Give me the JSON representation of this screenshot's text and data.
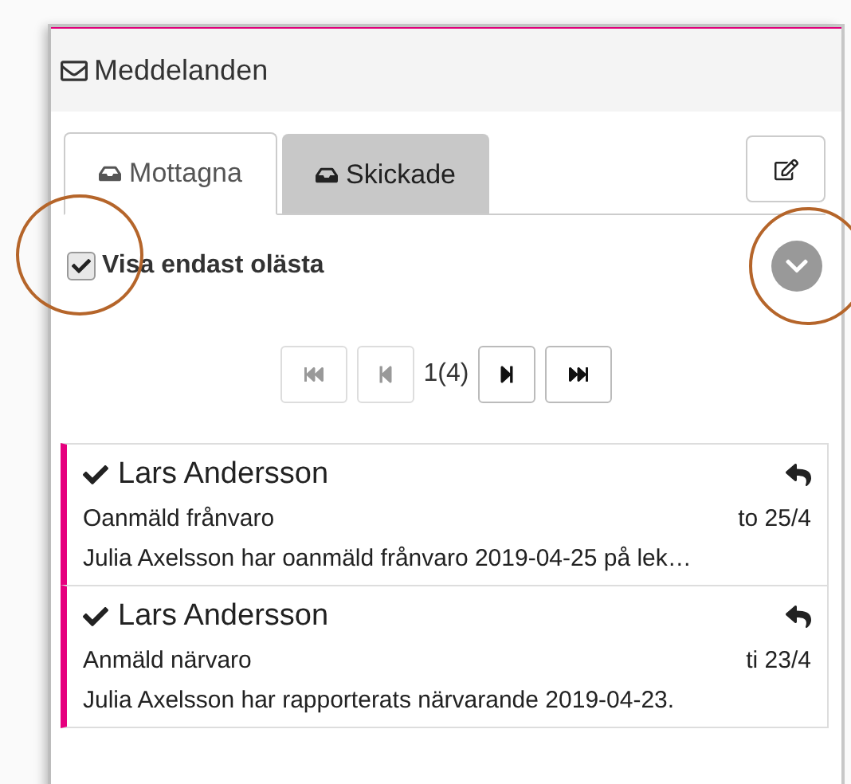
{
  "panel": {
    "title": "Meddelanden"
  },
  "tabs": [
    {
      "label": "Mottagna",
      "selected": true
    },
    {
      "label": "Skickade",
      "selected": false
    }
  ],
  "filter": {
    "label": "Visa endast olästa",
    "checked": true
  },
  "pager": {
    "reading": "1(4)",
    "buttons": [
      {
        "kind": "first",
        "disabled": true
      },
      {
        "kind": "prev",
        "disabled": true
      },
      {
        "kind": "next",
        "disabled": false
      },
      {
        "kind": "last",
        "disabled": false
      }
    ]
  },
  "messages": [
    {
      "sender": "Lars Andersson",
      "read": true,
      "unread_bar": true,
      "subject": "Oanmäld frånvaro",
      "date": "to 25/4",
      "preview": "Julia Axelsson har oanmäld frånvaro 2019-04-25 på lek…"
    },
    {
      "sender": "Lars Andersson",
      "read": true,
      "unread_bar": true,
      "subject": "Anmäld närvaro",
      "date": "ti 23/4",
      "preview": "Julia Axelsson har rapporterats närvarande 2019-04-23."
    }
  ]
}
